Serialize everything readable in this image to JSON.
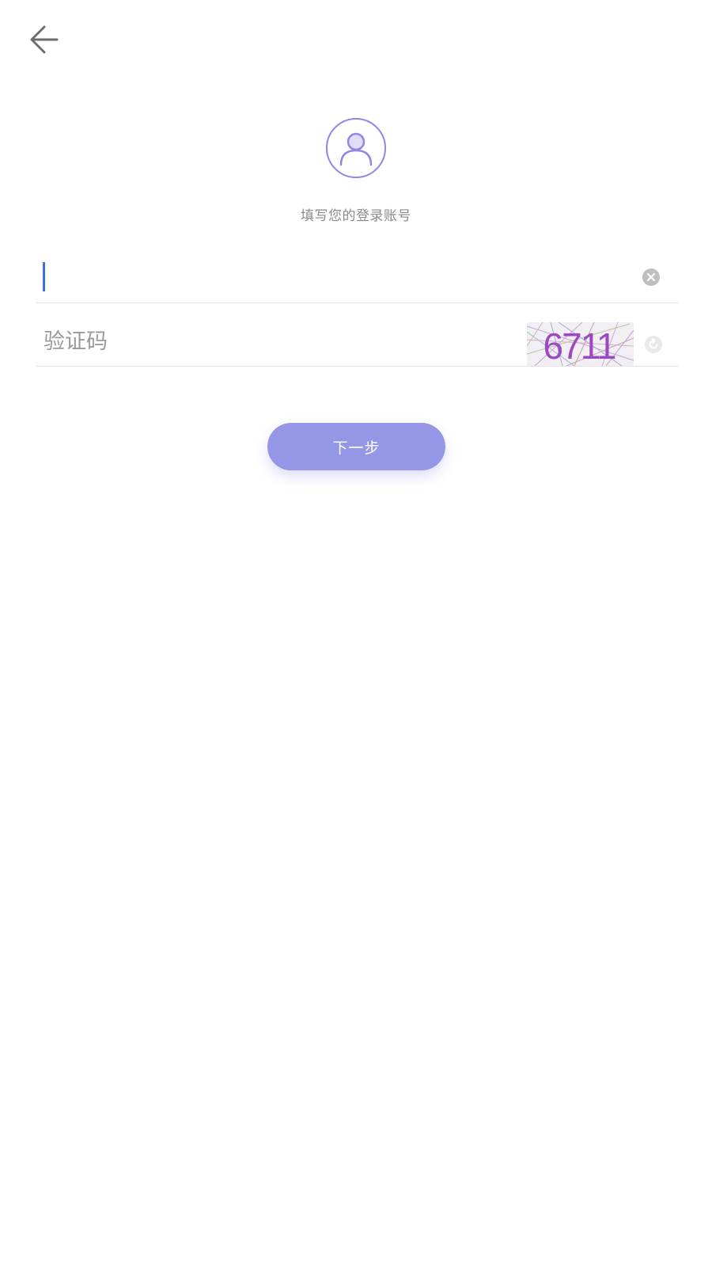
{
  "header": {
    "back_icon": "arrow-left-icon"
  },
  "account": {
    "avatar_icon": "user-avatar-icon",
    "prompt": "填写您的登录账号",
    "input_value": "",
    "clear_icon": "clear-circle-icon"
  },
  "captcha": {
    "placeholder": "验证码",
    "image_text": "6711",
    "refresh_icon": "refresh-icon"
  },
  "next_button": {
    "label": "下一步"
  },
  "colors": {
    "accent": "#9696e6",
    "avatar_stroke": "#8f86e8",
    "caret": "#3f6fd8",
    "text_muted": "#8a8a8a"
  }
}
